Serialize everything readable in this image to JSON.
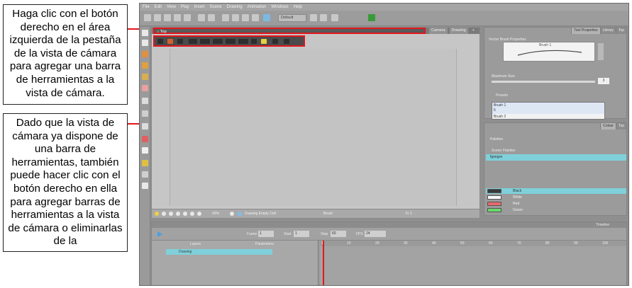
{
  "callouts": {
    "first": "Haga clic con el botón derecho en el área izquierda de la pestaña de la vista de cámara para agregar una barra de herramientas a la vista de cámara.",
    "second": "Dado que la vista de cámara ya dispone de una barra de herramientas, también puede hacer clic con el botón derecho en ella para agregar barras de herramientas a la vista de cámara o eliminarlas de la"
  },
  "menu": [
    "File",
    "Edit",
    "View",
    "Play",
    "Insert",
    "Scene",
    "Drawing",
    "Animation",
    "Windows",
    "Help"
  ],
  "toolbar": {
    "layout": "Default"
  },
  "camera_view": {
    "tab_label": "Top",
    "right_tabs": [
      "Camera",
      "Drawing"
    ],
    "status": {
      "zoom": "42%",
      "drawing": "Drawing Empty Cell",
      "tool": "Brush",
      "frame": "Fr 1"
    }
  },
  "tool_properties": {
    "tabs": [
      "Tool Properties",
      "Library",
      "Top"
    ],
    "section": "Vector Brush Properties",
    "preset_name": "Brush 1",
    "max_size_label": "Maximum Size",
    "max_size_value": "3",
    "presets_label": "Presets",
    "brushes": [
      {
        "name": "Brush 1",
        "size": "5"
      },
      {
        "name": "Brush 2"
      }
    ]
  },
  "colour_panel": {
    "tabs": [
      "Colour",
      "Top"
    ],
    "palettes_label": "Palettes",
    "scene_palettes_label": "Scene Palettes",
    "palette_name": "fgregre",
    "colours": [
      {
        "name": "Black",
        "hex": "#3a3a3a"
      },
      {
        "name": "White",
        "hex": "#ffffff"
      },
      {
        "name": "Red",
        "hex": "#e86a6a"
      },
      {
        "name": "Green",
        "hex": "#6ad86a"
      }
    ]
  },
  "timeline": {
    "title": "Timeline",
    "frame_label": "Frame",
    "frame_value": "1",
    "start_label": "Start",
    "start_value": "1",
    "stop_label": "Stop",
    "stop_value": "60",
    "fps_label": "FPS",
    "fps_value": "24",
    "layers_header": "Layers",
    "parameters_header": "Parameters",
    "layer_name": "Drawing",
    "ruler": [
      "1",
      "10",
      "20",
      "30",
      "40",
      "50",
      "60",
      "70",
      "80",
      "90",
      "100"
    ]
  },
  "accent": "#e2161c"
}
